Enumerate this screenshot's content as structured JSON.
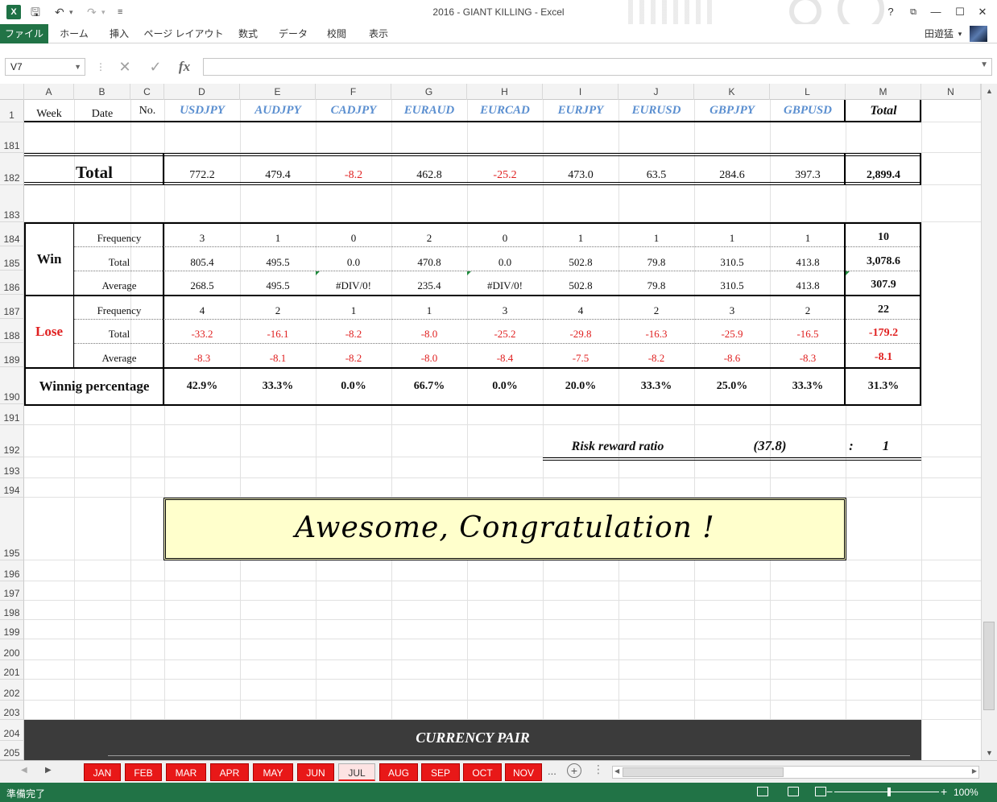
{
  "window": {
    "title": "2016 - GIANT KILLING - Excel",
    "help": "?",
    "qat_save": "🖫",
    "qat_undo": "↶",
    "qat_redo": "↷",
    "qat_more": "≡"
  },
  "ribbon": {
    "tabs": [
      "ファイル",
      "ホーム",
      "挿入",
      "ページ レイアウト",
      "数式",
      "データ",
      "校閲",
      "表示"
    ],
    "user": "田遊猛"
  },
  "formula_bar": {
    "name_box": "V7",
    "formula": ""
  },
  "columns": [
    "A",
    "B",
    "C",
    "D",
    "E",
    "F",
    "G",
    "H",
    "I",
    "J",
    "K",
    "L",
    "M",
    "N"
  ],
  "rows": [
    "1",
    "181",
    "182",
    "183",
    "184",
    "185",
    "186",
    "187",
    "188",
    "189",
    "190",
    "191",
    "192",
    "193",
    "194",
    "195",
    "196",
    "197",
    "198",
    "199",
    "200",
    "201",
    "202",
    "203",
    "204",
    "205"
  ],
  "sheet": {
    "header": {
      "week": "Week",
      "date": "Date",
      "no": "No.",
      "pairs": [
        "USDJPY",
        "AUDJPY",
        "CADJPY",
        "EURAUD",
        "EURCAD",
        "EURJPY",
        "EURUSD",
        "GBPJPY",
        "GBPUSD"
      ],
      "total": "Total"
    },
    "total_row": {
      "label": "Total",
      "values": [
        "772.2",
        "479.4",
        "-8.2",
        "462.8",
        "-25.2",
        "473.0",
        "63.5",
        "284.6",
        "397.3"
      ],
      "sum": "2,899.4"
    },
    "win": {
      "label": "Win",
      "frequency_label": "Frequency",
      "total_label": "Total",
      "average_label": "Average",
      "frequency": [
        "3",
        "1",
        "0",
        "2",
        "0",
        "1",
        "1",
        "1",
        "1"
      ],
      "frequency_sum": "10",
      "total": [
        "805.4",
        "495.5",
        "0.0",
        "470.8",
        "0.0",
        "502.8",
        "79.8",
        "310.5",
        "413.8"
      ],
      "total_sum": "3,078.6",
      "average": [
        "268.5",
        "495.5",
        "#DIV/0!",
        "235.4",
        "#DIV/0!",
        "502.8",
        "79.8",
        "310.5",
        "413.8"
      ],
      "average_sum": "307.9"
    },
    "lose": {
      "label": "Lose",
      "frequency_label": "Frequency",
      "total_label": "Total",
      "average_label": "Average",
      "frequency": [
        "4",
        "2",
        "1",
        "1",
        "3",
        "4",
        "2",
        "3",
        "2"
      ],
      "frequency_sum": "22",
      "total": [
        "-33.2",
        "-16.1",
        "-8.2",
        "-8.0",
        "-25.2",
        "-29.8",
        "-16.3",
        "-25.9",
        "-16.5"
      ],
      "total_sum": "-179.2",
      "average": [
        "-8.3",
        "-8.1",
        "-8.2",
        "-8.0",
        "-8.4",
        "-7.5",
        "-8.2",
        "-8.6",
        "-8.3"
      ],
      "average_sum": "-8.1"
    },
    "winning": {
      "label": "Winnig percentage",
      "values": [
        "42.9%",
        "33.3%",
        "0.0%",
        "66.7%",
        "0.0%",
        "20.0%",
        "33.3%",
        "25.0%",
        "33.3%"
      ],
      "sum": "31.3%"
    },
    "risk_reward": {
      "label": "Risk reward ratio",
      "value": "(37.8)",
      "separator": ":",
      "ratio": "1"
    },
    "banner": "Awesome, Congratulation !",
    "currency_pair": "CURRENCY PAIR"
  },
  "sheet_tabs": [
    "JAN",
    "FEB",
    "MAR",
    "APR",
    "MAY",
    "JUN",
    "JUL",
    "AUG",
    "SEP",
    "OCT",
    "NOV"
  ],
  "active_tab": "JUL",
  "tab_more": "...",
  "status": {
    "text": "準備完了",
    "zoom": "100%"
  },
  "colors": {
    "excel_green": "#217346",
    "tab_red": "#e81818",
    "pair_blue": "#5b8fd0",
    "negative_red": "#e02020",
    "banner_yellow": "#ffffcc"
  }
}
